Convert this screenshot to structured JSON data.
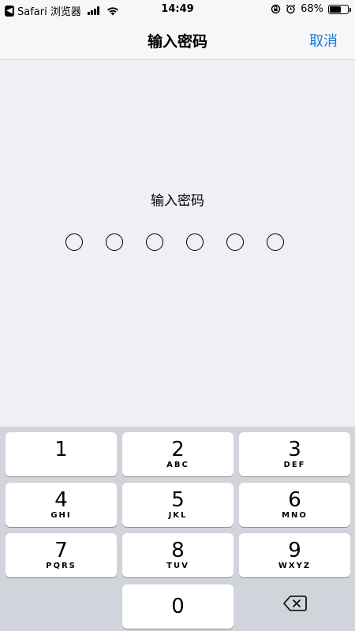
{
  "status_bar": {
    "back_app_label": "Safari 浏览器",
    "time": "14:49",
    "battery_percent_text": "68%",
    "battery_level": 0.68
  },
  "nav": {
    "title": "输入密码",
    "cancel_label": "取消"
  },
  "prompt": "输入密码",
  "passcode_length": 6,
  "keypad": {
    "keys": [
      {
        "num": "1",
        "letters": ""
      },
      {
        "num": "2",
        "letters": "ABC"
      },
      {
        "num": "3",
        "letters": "DEF"
      },
      {
        "num": "4",
        "letters": "GHI"
      },
      {
        "num": "5",
        "letters": "JKL"
      },
      {
        "num": "6",
        "letters": "MNO"
      },
      {
        "num": "7",
        "letters": "PQRS"
      },
      {
        "num": "8",
        "letters": "TUV"
      },
      {
        "num": "9",
        "letters": "WXYZ"
      },
      {
        "num": "0",
        "letters": ""
      }
    ]
  },
  "colors": {
    "accent": "#1a7ae3",
    "keypad_background": "#d1d4da",
    "page_background": "#efeff4"
  }
}
